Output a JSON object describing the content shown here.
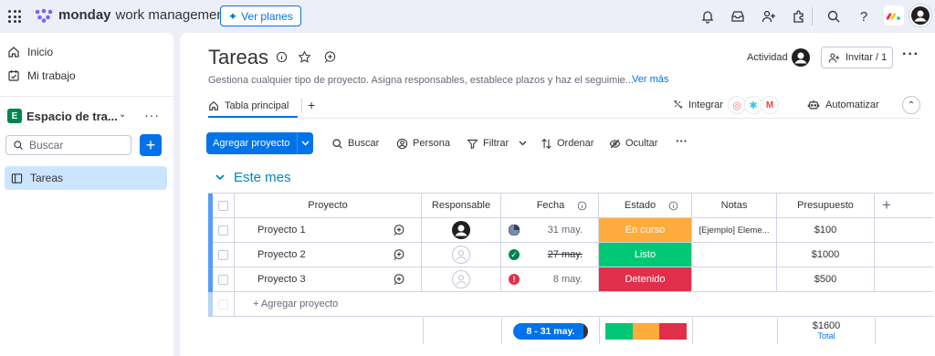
{
  "topbar": {
    "brand": "monday",
    "product": "work management",
    "plans_button": "Ver planes"
  },
  "sidebar": {
    "home": "Inicio",
    "my_work": "Mi trabajo",
    "workspace_badge": "E",
    "workspace_name": "Espacio de tra...",
    "search_placeholder": "Buscar",
    "add_label": "+",
    "board_item": "Tareas"
  },
  "board": {
    "title": "Tareas",
    "description": "Gestiona cualquier tipo de proyecto. Asigna responsables, establece plazos y haz el seguimie...",
    "see_more": "Ver más",
    "activity": "Actividad",
    "invite": "Invitar / 1",
    "tab_main": "Tabla principal",
    "tab_add": "+",
    "integrate": "Integrar",
    "automate": "Automatizar"
  },
  "toolbar": {
    "add_project": "Agregar proyecto",
    "search": "Buscar",
    "person": "Persona",
    "filter": "Filtrar",
    "sort": "Ordenar",
    "hide": "Ocultar",
    "more": "···"
  },
  "group": {
    "title": "Este mes",
    "color": "#579bfc"
  },
  "table": {
    "headers": {
      "project": "Proyecto",
      "owner": "Responsable",
      "date": "Fecha",
      "status": "Estado",
      "notes": "Notas",
      "budget": "Presupuesto",
      "add_column": "+"
    },
    "rows": [
      {
        "name": "Proyecto 1",
        "date": "31 may.",
        "status": "En curso",
        "status_color": "#fdab3d",
        "notes": "[Ejemplo] Eleme...",
        "budget": "$100",
        "date_icon": "half-clock-icon",
        "owner": "filled"
      },
      {
        "name": "Proyecto 2",
        "date": "27 may.",
        "status": "Listo",
        "status_color": "#00c875",
        "notes": "",
        "budget": "$1000",
        "date_icon": "check-icon",
        "owner": "empty"
      },
      {
        "name": "Proyecto 3",
        "date": "8 may.",
        "status": "Detenido",
        "status_color": "#df2f4a",
        "notes": "",
        "budget": "$500",
        "date_icon": "alert-icon",
        "owner": "empty"
      }
    ],
    "add_row": "+ Agregar proyecto"
  },
  "summary": {
    "date_range": "8 - 31 may.",
    "status_distribution": [
      {
        "color": "#00c875",
        "fraction": 0.3333
      },
      {
        "color": "#fdab3d",
        "fraction": 0.3333
      },
      {
        "color": "#df2f4a",
        "fraction": 0.3334
      }
    ],
    "budget_total": "$1600",
    "budget_label": "Total"
  }
}
